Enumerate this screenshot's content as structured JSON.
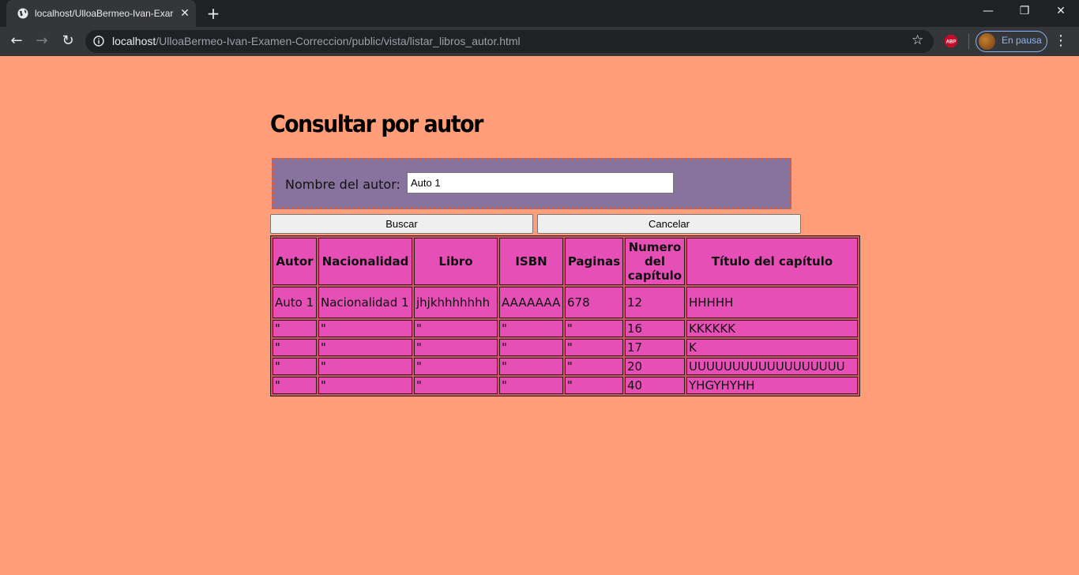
{
  "browser": {
    "tab_title": "localhost/UlloaBermeo-Ivan-Exar",
    "new_tab_label": "+",
    "url_host": "localhost",
    "url_path": "/UlloaBermeo-Ivan-Examen-Correccion/public/vista/listar_libros_autor.html",
    "profile_status": "En pausa",
    "extension_label": "ABP"
  },
  "page": {
    "title": "Consultar por autor",
    "author_label": "Nombre del autor:",
    "author_value": "Auto 1",
    "search_button": "Buscar",
    "cancel_button": "Cancelar"
  },
  "table": {
    "headers": [
      "Autor",
      "Nacionalidad",
      "Libro",
      "ISBN",
      "Paginas",
      "Numero del capítulo",
      "Título del capítulo"
    ],
    "rows": [
      [
        "Auto 1",
        "Nacionalidad 1",
        "jhjkhhhhhhh",
        "AAAAAAA",
        "678",
        "12",
        "HHHHH"
      ],
      [
        "\"",
        "\"",
        "\"",
        "\"",
        "\"",
        "16",
        "KKKKKK"
      ],
      [
        "\"",
        "\"",
        "\"",
        "\"",
        "\"",
        "17",
        "K"
      ],
      [
        "\"",
        "\"",
        "\"",
        "\"",
        "\"",
        "20",
        "UUUUUUUUUUUUUUUUUU"
      ],
      [
        "\"",
        "\"",
        "\"",
        "\"",
        "\"",
        "40",
        "YHGYHYHH"
      ]
    ]
  },
  "colors": {
    "page_background": "#ff9e79",
    "search_box_background": "#88739e",
    "search_box_border": "#e65c33",
    "table_cell_background": "#e650b6",
    "table_border": "#e04f5f"
  }
}
